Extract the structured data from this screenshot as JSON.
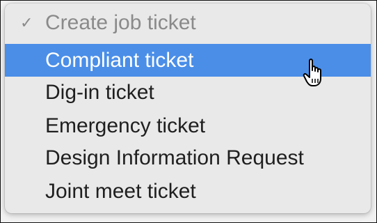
{
  "menu": {
    "items": [
      {
        "label": "Create job ticket",
        "checked": true,
        "disabled": true
      },
      {
        "label": "Compliant ticket",
        "highlighted": true
      },
      {
        "label": "Dig-in ticket"
      },
      {
        "label": "Emergency ticket"
      },
      {
        "label": "Design Information Request"
      },
      {
        "label": "Joint meet ticket"
      }
    ],
    "check_symbol": "✓"
  },
  "colors": {
    "highlight": "#4a8ee8",
    "menu_bg": "#e9e9e9",
    "text": "#1f1f1f",
    "muted_text": "#8a8a8a"
  },
  "icons": {
    "cursor": "pointing-hand-cursor-icon",
    "check": "checkmark-icon"
  }
}
